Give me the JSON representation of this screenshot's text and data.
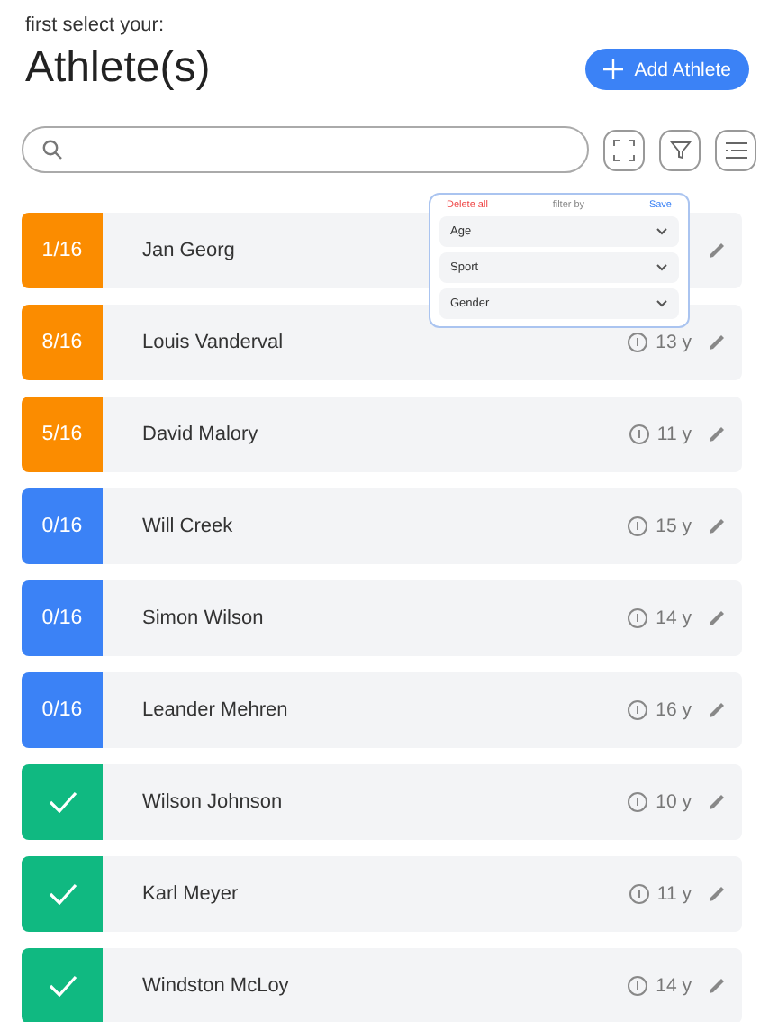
{
  "header": {
    "subtitle": "first select your:",
    "title": "Athlete(s)",
    "add_button": "Add Athlete"
  },
  "filter_popup": {
    "delete_label": "Delete all",
    "title": "filter by",
    "save_label": "Save",
    "fields": [
      {
        "label": "Age"
      },
      {
        "label": "Sport"
      },
      {
        "label": "Gender"
      }
    ]
  },
  "athletes": [
    {
      "kind": "progress",
      "progress": "1/16",
      "color": "#fb8c00",
      "name": "Jan Georg"
    },
    {
      "kind": "progress",
      "progress": "8/16",
      "color": "#fb8c00",
      "name": "Louis Vanderval",
      "age": "13 y"
    },
    {
      "kind": "progress",
      "progress": "5/16",
      "color": "#fb8c00",
      "name": "David Malory",
      "age": "11 y"
    },
    {
      "kind": "progress",
      "progress": "0/16",
      "color": "#3b82f6",
      "name": "Will Creek",
      "age": "15 y"
    },
    {
      "kind": "progress",
      "progress": "0/16",
      "color": "#3b82f6",
      "name": "Simon Wilson",
      "age": "14 y"
    },
    {
      "kind": "progress",
      "progress": "0/16",
      "color": "#3b82f6",
      "name": "Leander Mehren",
      "age": "16 y"
    },
    {
      "kind": "done",
      "color": "#10b981",
      "name": "Wilson Johnson",
      "age": "10 y"
    },
    {
      "kind": "done",
      "color": "#10b981",
      "name": "Karl Meyer",
      "age": "11 y"
    },
    {
      "kind": "done",
      "color": "#10b981",
      "name": "Windston McLoy",
      "age": "14 y"
    }
  ]
}
